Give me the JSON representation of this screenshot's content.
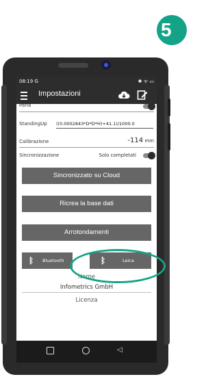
{
  "step_number": "5",
  "status_bar": {
    "time": "08:19 G",
    "icons": "✱ ᯤ ▭"
  },
  "app_bar": {
    "title": "Impostazioni",
    "icons": [
      "menu-icon",
      "cloud-download-icon",
      "edit-icon"
    ]
  },
  "settings": {
    "parla_label": "Parla",
    "standing_label": "StandingUp",
    "standing_formula": "((0.0002843*D*D*H)+41.1)/1000.0",
    "calibration_label": "Calibrazione",
    "calibration_value": "-114",
    "calibration_unit": "mm",
    "sync_label": "Sincronizzazione",
    "sync_value": "Solo completati"
  },
  "buttons": {
    "sync_cloud": "Sincronizzato su Cloud",
    "recreate_db": "Ricrea la base dati",
    "rounding": "Arrotondamenti",
    "bluetooth": "Bluetooth",
    "leica": "Leica"
  },
  "info": {
    "name_label": "Nome",
    "name_value": "Infometrics GmbH",
    "license_label": "Licenza"
  },
  "colors": {
    "accent": "#14a386",
    "app_bar": "#2d2d2d",
    "button": "#666666"
  }
}
